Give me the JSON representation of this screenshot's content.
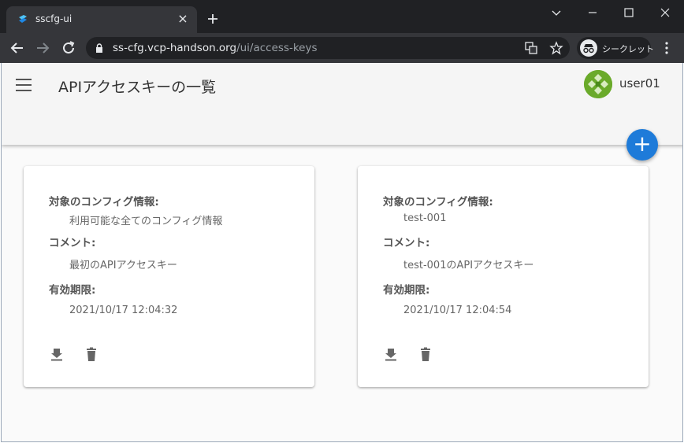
{
  "browser": {
    "tab_title": "sscfg-ui",
    "url_host": "ss-cfg.vcp-handson.org",
    "url_path": "/ui/access-keys",
    "incognito_label": "シークレット"
  },
  "header": {
    "title": "APIアクセスキーの一覧",
    "username": "user01"
  },
  "fab_label": "+",
  "cards": [
    {
      "config_label": "対象のコンフィグ情報:",
      "config_value": "利用可能な全てのコンフィグ情報",
      "comment_label": "コメント:",
      "comment_value": "最初のAPIアクセスキー",
      "expiry_label": "有効期限:",
      "expiry_value": "2021/10/17 12:04:32"
    },
    {
      "config_label": "対象のコンフィグ情報:",
      "config_value": "test-001",
      "comment_label": "コメント:",
      "comment_value": "test-001のAPIアクセスキー",
      "expiry_label": "有効期限:",
      "expiry_value": "2021/10/17 12:04:54"
    }
  ]
}
